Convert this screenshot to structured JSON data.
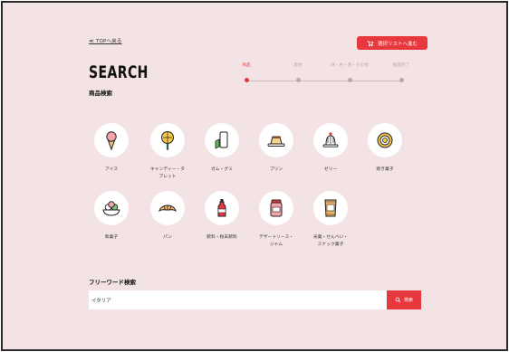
{
  "nav": {
    "top_link": "≪ TOPへ戻る",
    "cart_button": "選択リストへ進む"
  },
  "page": {
    "title": "SEARCH",
    "subtitle": "商品検索"
  },
  "steps": [
    {
      "label": "商品",
      "active": true
    },
    {
      "label": "素材",
      "active": false
    },
    {
      "label": "味・色・香・その他",
      "active": false
    },
    {
      "label": "検索完了",
      "active": false
    }
  ],
  "categories": [
    {
      "label": "アイス",
      "icon": "ice-cream-icon"
    },
    {
      "label": "キャンディー・タ\nブレット",
      "icon": "lollipop-icon"
    },
    {
      "label": "ガム・グミ",
      "icon": "gum-icon"
    },
    {
      "label": "プリン",
      "icon": "pudding-icon"
    },
    {
      "label": "ゼリー",
      "icon": "jelly-icon"
    },
    {
      "label": "焼き菓子",
      "icon": "baked-sweets-icon"
    },
    {
      "label": "和菓子",
      "icon": "japanese-sweets-icon"
    },
    {
      "label": "パン",
      "icon": "croissant-icon"
    },
    {
      "label": "飲料・粉末飲料",
      "icon": "drink-bottle-icon"
    },
    {
      "label": "デザートソース・\nジャム",
      "icon": "jam-jar-icon"
    },
    {
      "label": "米菓・せんべい・\nスナック菓子",
      "icon": "snack-bag-icon"
    }
  ],
  "freeword": {
    "title": "フリーワード検索",
    "value": "イタリア",
    "button": "検索"
  },
  "colors": {
    "accent": "#e6383d",
    "background": "#f4e3e4"
  }
}
